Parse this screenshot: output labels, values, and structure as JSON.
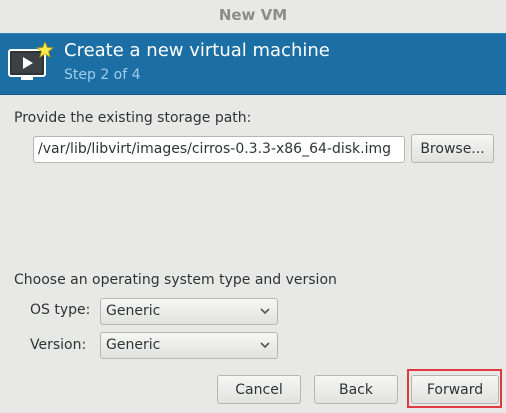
{
  "window": {
    "title": "New VM"
  },
  "header": {
    "title": "Create a new virtual machine",
    "step": "Step 2 of 4",
    "icon": "vm-screen-star-icon"
  },
  "storage": {
    "label": "Provide the existing storage path:",
    "path_value": "/var/lib/libvirt/images/cirros-0.3.3-x86_64-disk.img",
    "browse_label": "Browse..."
  },
  "os": {
    "section_label": "Choose an operating system type and version",
    "type_label": "OS type:",
    "type_value": "Generic",
    "version_label": "Version:",
    "version_value": "Generic"
  },
  "footer": {
    "cancel_label": "Cancel",
    "back_label": "Back",
    "forward_label": "Forward"
  },
  "colors": {
    "banner": "#1c6fa4",
    "highlight": "#e03a3e"
  }
}
